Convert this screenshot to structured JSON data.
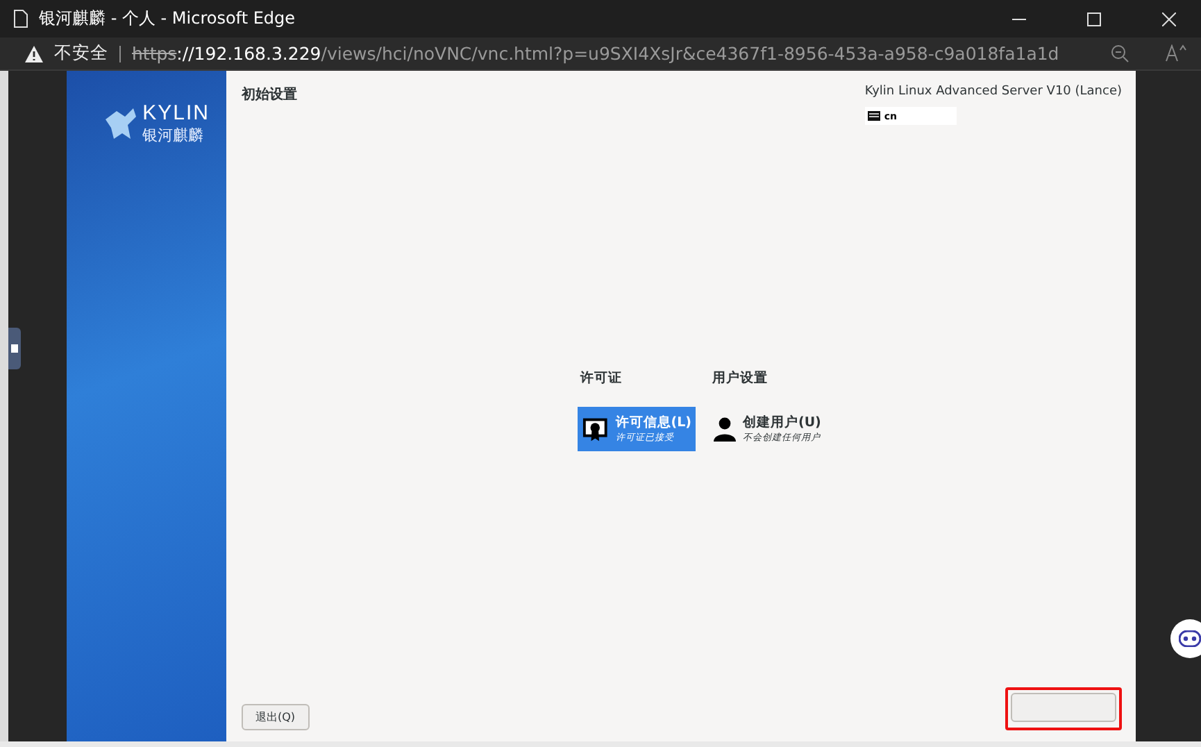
{
  "browser": {
    "title": "银河麒麟 - 个人 - Microsoft Edge",
    "security": "不安全",
    "url": {
      "scheme": "https",
      "host": "://192.168.3.229",
      "path": "/views/hci/noVNC/vnc.html?p=u9SXI4XsJr&ce4367f1-8956-453a-a958-c9a018fa1a1d"
    }
  },
  "installer": {
    "logo": {
      "name": "KYLIN",
      "subtitle": "银河麒麟"
    },
    "title": "初始设置",
    "product": "Kylin Linux Advanced Server V10 (Lance)",
    "keyboard": "cn",
    "sections": [
      {
        "heading": "许可证",
        "items": [
          {
            "kind": "license",
            "title": "许可信息(L)",
            "subtitle": "许可证已接受",
            "selected": true
          }
        ]
      },
      {
        "heading": "用户设置",
        "items": [
          {
            "kind": "user",
            "title": "创建用户(U)",
            "subtitle": "不会创建任何用户",
            "selected": false
          }
        ]
      }
    ],
    "quit_button": "退出(Q)",
    "finish_button": {
      "highlighted": true
    }
  }
}
